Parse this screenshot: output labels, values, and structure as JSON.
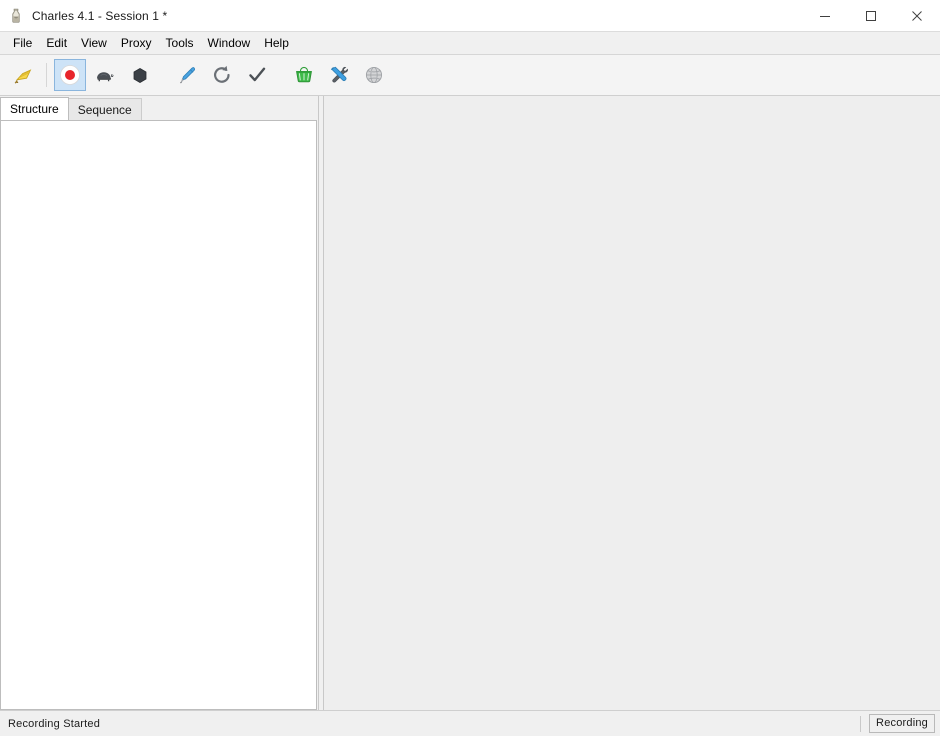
{
  "window": {
    "title": "Charles 4.1 - Session 1 *",
    "app_icon": "charles-bottle-icon",
    "controls": {
      "minimize": "minimize-icon",
      "maximize": "maximize-icon",
      "close": "close-icon"
    }
  },
  "menubar": {
    "items": [
      {
        "label": "File"
      },
      {
        "label": "Edit"
      },
      {
        "label": "View"
      },
      {
        "label": "Proxy"
      },
      {
        "label": "Tools"
      },
      {
        "label": "Window"
      },
      {
        "label": "Help"
      }
    ]
  },
  "toolbar": {
    "buttons": [
      {
        "name": "clear-session-button",
        "icon": "broom-icon",
        "selected": false
      },
      {
        "name": "record-button",
        "icon": "record-icon",
        "selected": true
      },
      {
        "name": "throttle-button",
        "icon": "turtle-icon",
        "selected": false
      },
      {
        "name": "breakpoints-button",
        "icon": "hexagon-icon",
        "selected": false
      },
      {
        "name": "compose-button",
        "icon": "pen-icon",
        "selected": false
      },
      {
        "name": "repeat-button",
        "icon": "repeat-arrow-icon",
        "selected": false
      },
      {
        "name": "validate-button",
        "icon": "checkmark-icon",
        "selected": false
      },
      {
        "name": "tools-basket-button",
        "icon": "basket-icon",
        "selected": false
      },
      {
        "name": "tools-settings-button",
        "icon": "wrench-screwdriver-icon",
        "selected": false
      },
      {
        "name": "dns-spoofing-button",
        "icon": "globe-icon",
        "selected": false
      }
    ]
  },
  "left_pane": {
    "tabs": [
      {
        "label": "Structure",
        "active": true
      },
      {
        "label": "Sequence",
        "active": false
      }
    ],
    "tree_items": []
  },
  "right_pane": {
    "content": ""
  },
  "statusbar": {
    "message": "Recording Started",
    "recording_indicator": "Recording"
  },
  "colors": {
    "window_bg": "#f0f0f0",
    "toolbar_bg": "#f4f4f4",
    "content_bg": "#eeeeee",
    "tree_bg": "#ffffff",
    "selection_blue": "#cde3f7",
    "record_red": "#e8242a",
    "basket_green": "#29a331",
    "pen_blue": "#2d8fd6"
  }
}
